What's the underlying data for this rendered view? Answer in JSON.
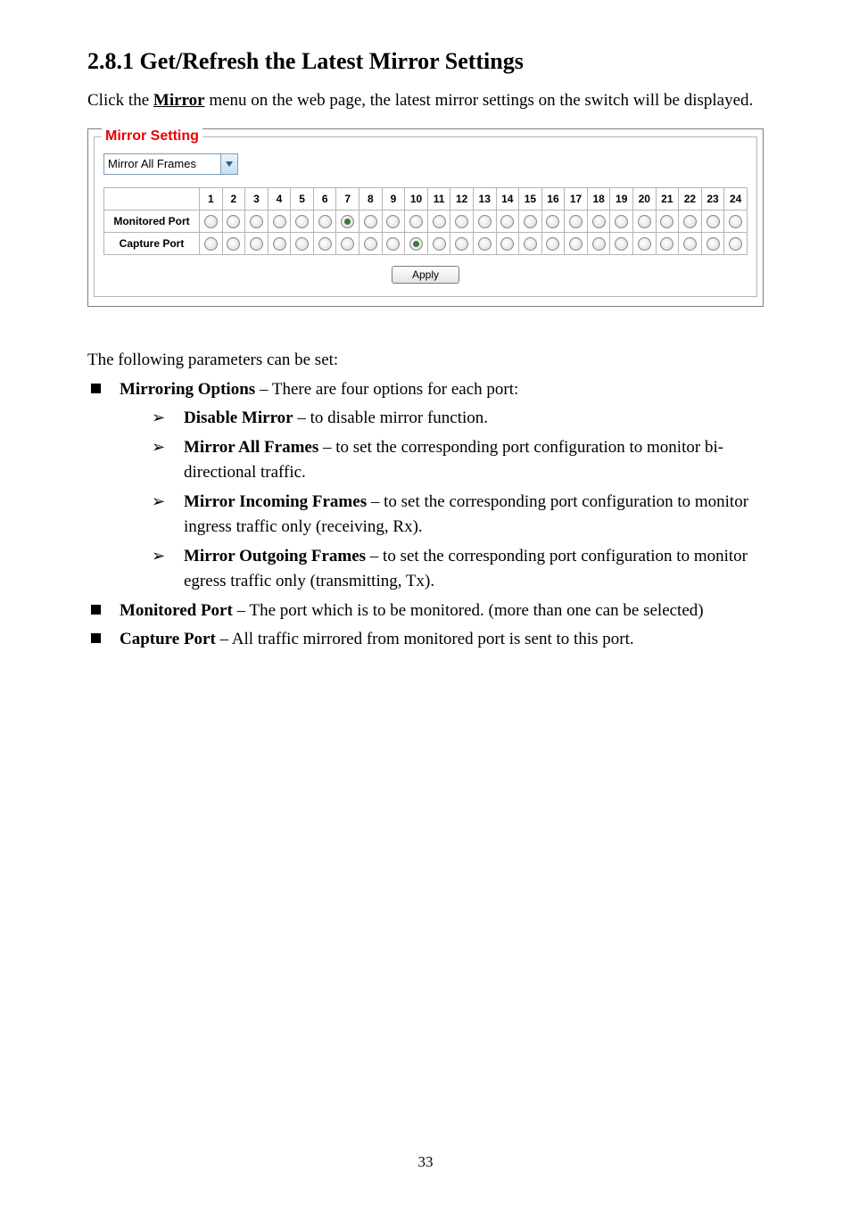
{
  "heading": "2.8.1   Get/Refresh the Latest Mirror Settings",
  "intro_prefix": "Click the ",
  "intro_menu_name": "Mirror",
  "intro_suffix": " menu on the web page, the latest mirror settings on the switch will be displayed.",
  "panel": {
    "legend": "Mirror Setting",
    "dropdown_value": "Mirror All Frames",
    "port_count": 24,
    "monitored_label": "Monitored Port",
    "capture_label": "Capture Port",
    "monitored_selected": 7,
    "capture_selected": 10,
    "apply_label": "Apply"
  },
  "param_intro": "The following parameters can be set:",
  "bullets": [
    {
      "label": "Mirroring Options",
      "desc": " – There are four options for each port:",
      "subitems": [
        {
          "label": "Disable Mirror",
          "desc": " – to disable mirror function."
        },
        {
          "label": "Mirror All Frames",
          "desc": " – to set the corresponding port configuration to monitor bi-directional traffic."
        },
        {
          "label": "Mirror Incoming Frames",
          "desc": " – to set the corresponding port configuration to monitor ingress traffic only (receiving, Rx)."
        },
        {
          "label": "Mirror Outgoing Frames",
          "desc": " – to set the corresponding port configuration to monitor egress traffic only (transmitting, Tx)."
        }
      ]
    },
    {
      "label": "Monitored Port",
      "desc": " – The port which is to be monitored. (more than one can be selected)"
    },
    {
      "label": "Capture Port",
      "desc": " – All traffic mirrored from monitored port is sent to this port."
    }
  ],
  "page_number": "33",
  "chart_data": {
    "type": "table",
    "title": "Mirror Setting port selection",
    "columns": [
      "1",
      "2",
      "3",
      "4",
      "5",
      "6",
      "7",
      "8",
      "9",
      "10",
      "11",
      "12",
      "13",
      "14",
      "15",
      "16",
      "17",
      "18",
      "19",
      "20",
      "21",
      "22",
      "23",
      "24"
    ],
    "rows": [
      {
        "name": "Monitored Port",
        "selected_port": 7
      },
      {
        "name": "Capture Port",
        "selected_port": 10
      }
    ],
    "dropdown": "Mirror All Frames"
  }
}
